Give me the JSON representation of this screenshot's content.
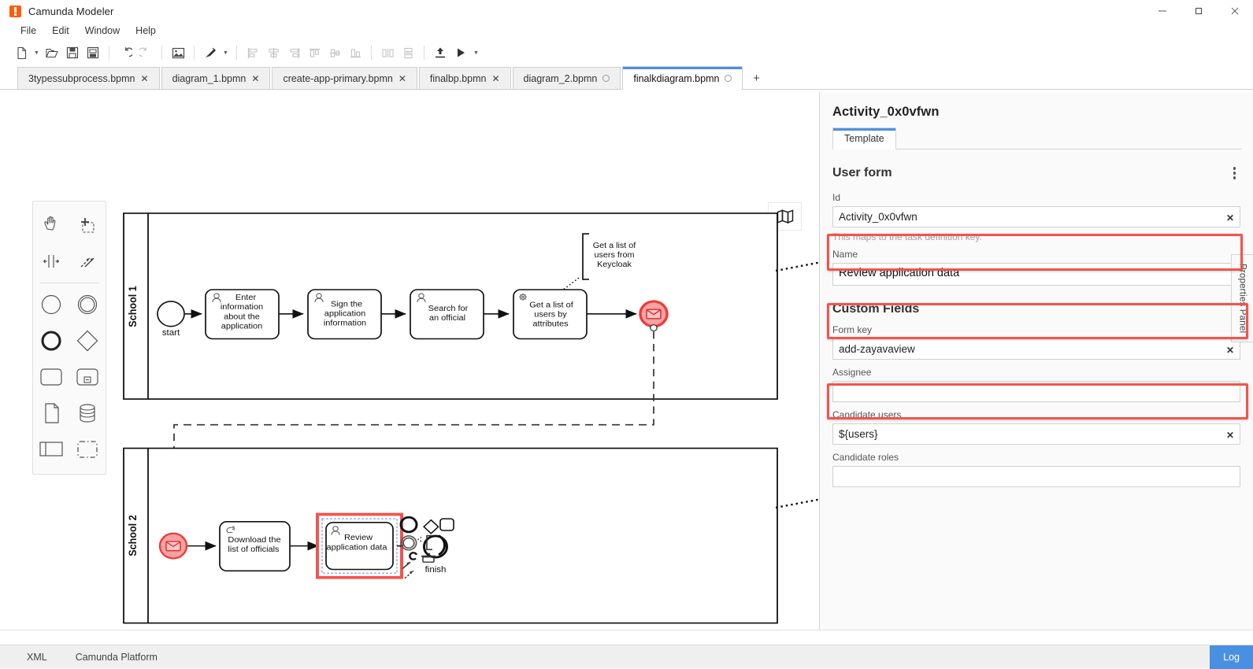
{
  "window": {
    "app_title": "Camunda Modeler",
    "logo": "camunda-logo-icon",
    "controls": {
      "minimize": "—",
      "maximize": "❐",
      "close": "✕"
    }
  },
  "menubar": {
    "items": [
      "File",
      "Edit",
      "Window",
      "Help"
    ]
  },
  "toolbar": {
    "items": [
      {
        "name": "new-file-icon",
        "disabled": false
      },
      {
        "name": "new-file-dropdown-caret",
        "disabled": false
      },
      {
        "name": "open-folder-icon",
        "disabled": false
      },
      {
        "name": "save-icon",
        "disabled": false
      },
      {
        "name": "save-as-icon",
        "disabled": false
      },
      {
        "name": "undo-icon",
        "disabled": false
      },
      {
        "name": "redo-icon",
        "disabled": true
      },
      {
        "name": "export-image-icon",
        "disabled": false
      },
      {
        "name": "align-tool-icon",
        "disabled": false
      },
      {
        "name": "align-tool-caret",
        "disabled": false
      },
      {
        "name": "align-left-icon",
        "disabled": true
      },
      {
        "name": "align-center-horizontal-icon",
        "disabled": true
      },
      {
        "name": "align-right-icon",
        "disabled": true
      },
      {
        "name": "align-top-icon",
        "disabled": true
      },
      {
        "name": "align-middle-icon",
        "disabled": true
      },
      {
        "name": "align-bottom-icon",
        "disabled": true
      },
      {
        "name": "distribute-horizontal-icon",
        "disabled": true
      },
      {
        "name": "distribute-vertical-icon",
        "disabled": true
      },
      {
        "name": "deploy-icon",
        "disabled": false
      },
      {
        "name": "start-instance-icon",
        "disabled": false
      },
      {
        "name": "start-instance-caret",
        "disabled": false
      }
    ]
  },
  "tabs": {
    "items": [
      {
        "label": "3typessubprocess.bpmn",
        "active": false,
        "indicator": "close"
      },
      {
        "label": "diagram_1.bpmn",
        "active": false,
        "indicator": "close"
      },
      {
        "label": "create-app-primary.bpmn",
        "active": false,
        "indicator": "close"
      },
      {
        "label": "finalbp.bpmn",
        "active": false,
        "indicator": "close"
      },
      {
        "label": "diagram_2.bpmn",
        "active": false,
        "indicator": "dot"
      },
      {
        "label": "finalkdiagram.bpmn",
        "active": true,
        "indicator": "dot"
      }
    ],
    "add_label": "+"
  },
  "palette": {
    "tools": [
      {
        "name": "hand-tool-icon"
      },
      {
        "name": "lasso-tool-icon"
      },
      {
        "name": "space-tool-icon"
      },
      {
        "name": "global-connect-tool-icon"
      },
      {
        "name": "start-event-icon"
      },
      {
        "name": "intermediate-event-icon"
      },
      {
        "name": "end-event-icon"
      },
      {
        "name": "gateway-icon"
      },
      {
        "name": "task-icon"
      },
      {
        "name": "subprocess-icon"
      },
      {
        "name": "data-object-icon"
      },
      {
        "name": "data-store-icon"
      },
      {
        "name": "participant-icon"
      },
      {
        "name": "group-icon"
      }
    ]
  },
  "canvas": {
    "minimap_icon": "map-icon",
    "pools": [
      {
        "label": "School 1"
      },
      {
        "label": "School 2"
      }
    ],
    "elements": {
      "start_event_label": "start",
      "task1": "Enter information about the application",
      "task2": "Sign the application information",
      "task3": "Search for an official",
      "task4": "Get a list of users by attributes",
      "annotation": "Get a list of users from Keycloak",
      "task5": "Download the list of officials",
      "task6": "Review application data",
      "end_event_label": "finish"
    },
    "context_pad": [
      {
        "name": "append-end-event-icon"
      },
      {
        "name": "append-gateway-icon"
      },
      {
        "name": "append-task-icon"
      },
      {
        "name": "append-intermediate-event-icon"
      },
      {
        "name": "append-text-annotation-icon"
      },
      {
        "name": "loop-characteristics-icon"
      },
      {
        "name": "change-type-icon"
      },
      {
        "name": "delete-icon"
      },
      {
        "name": "connect-icon"
      }
    ]
  },
  "properties_panel": {
    "vertical_tab_label": "Properties Panel",
    "title": "Activity_0x0vfwn",
    "tabs": [
      {
        "label": "Template",
        "active": true
      }
    ],
    "group_title": "User form",
    "menu_icon": "kebab-menu-icon",
    "fields": [
      {
        "key": "id",
        "label": "Id",
        "value": "Activity_0x0vfwn",
        "hint": "This maps to the task definition key.",
        "clearable": true,
        "highlighted": false,
        "type": "input"
      },
      {
        "key": "name",
        "label": "Name",
        "value": "Review application data",
        "clearable": false,
        "highlighted": true,
        "type": "textarea"
      }
    ],
    "custom_fields_title": "Custom Fields",
    "custom_fields": [
      {
        "key": "form_key",
        "label": "Form key",
        "value": "add-zayavaview",
        "placeholder": "",
        "clearable": true,
        "highlighted": true,
        "type": "input"
      },
      {
        "key": "assignee",
        "label": "Assignee",
        "value": "",
        "placeholder": "",
        "clearable": false,
        "highlighted": false,
        "type": "input"
      },
      {
        "key": "candidate_users",
        "label": "Candidate users",
        "value": "${users}",
        "placeholder": "",
        "clearable": true,
        "highlighted": true,
        "type": "input"
      },
      {
        "key": "candidate_roles",
        "label": "Candidate roles",
        "value": "",
        "placeholder": "",
        "clearable": false,
        "highlighted": false,
        "type": "input"
      }
    ],
    "clear_glyph": "✕"
  },
  "statusbar": {
    "items": [
      "XML",
      "Camunda Platform"
    ],
    "log_label": "Log"
  },
  "colors": {
    "highlight_red": "#f4534d",
    "accent_blue": "#4a90e2",
    "brand_orange": "#fc5d0d",
    "event_red_fill": "#f9bdbd",
    "event_red_stroke": "#e8373a"
  }
}
